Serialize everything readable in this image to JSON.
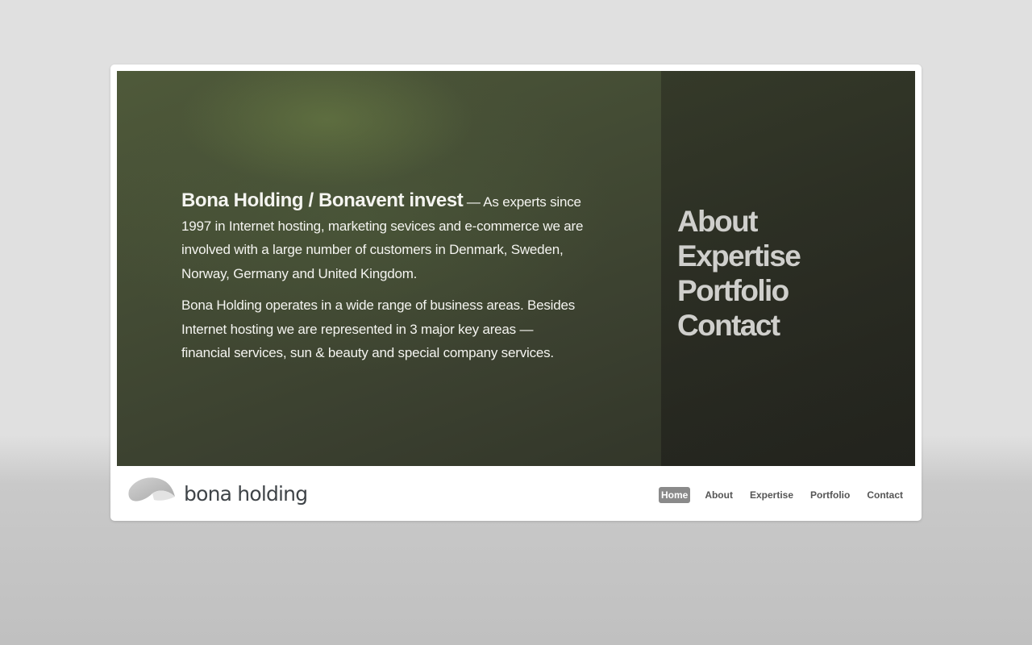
{
  "hero": {
    "lead_title": "Bona Holding / Bonavent invest",
    "lead_text": " — As experts since 1997 in Internet hosting, marketing sevices and e-commerce we are involved with a large number of customers in Denmark, Sweden, Norway, Germany and United Kingdom.",
    "paragraph2": "Bona Holding operates in a wide range of business areas. Besides Internet hosting we are represented in 3 major key areas — financial services, sun & beauty and special company services."
  },
  "big_nav": {
    "items": [
      "About",
      "Expertise",
      "Portfolio",
      "Contact"
    ]
  },
  "logo": {
    "text": "bona holding"
  },
  "footer_nav": {
    "items": [
      "Home",
      "About",
      "Expertise",
      "Portfolio",
      "Contact"
    ],
    "active": "Home"
  },
  "colors": {
    "page_bg": "#e0e0e0",
    "hero_green": "#4f5a3a",
    "big_nav_text": "#cfcfcc",
    "active_nav_bg": "#8a8a8a"
  }
}
